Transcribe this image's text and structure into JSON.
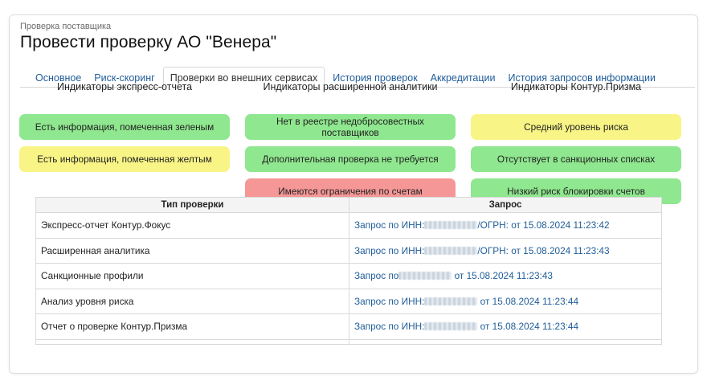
{
  "breadcrumb": "Проверка поставщика",
  "title": "Провести проверку АО \"Венера\"",
  "tabs": [
    {
      "label": "Основное"
    },
    {
      "label": "Риск-скоринг"
    },
    {
      "label": "Проверки во внешних сервисах"
    },
    {
      "label": "История проверок"
    },
    {
      "label": "Аккредитации"
    },
    {
      "label": "История запросов информации"
    }
  ],
  "columns": [
    {
      "title": "Индикаторы экспресс-отчета",
      "items": [
        {
          "text": "Есть информация, помеченная зеленым",
          "status": "green"
        },
        {
          "text": "Есть информация, помеченная желтым",
          "status": "yellow"
        }
      ]
    },
    {
      "title": "Индикаторы расширенной аналитики",
      "items": [
        {
          "text": "Нет в реестре недобросовестных поставщиков",
          "status": "green"
        },
        {
          "text": "Дополнительная проверка не требуется",
          "status": "green"
        },
        {
          "text": "Имеются ограничения по счетам",
          "status": "red"
        }
      ]
    },
    {
      "title": "Индикаторы Контур.Призма",
      "items": [
        {
          "text": "Средний уровень риска",
          "status": "yellow"
        },
        {
          "text": "Отсутствует в санкционных списках",
          "status": "green"
        },
        {
          "text": "Низкий риск блокировки счетов",
          "status": "green"
        }
      ]
    }
  ],
  "colors": {
    "green": "#8fe78f",
    "yellow": "#f8f586",
    "red": "#f59797",
    "link": "#1f5c99"
  },
  "table": {
    "headers": [
      "Тип проверки",
      "Запрос"
    ],
    "rows": [
      {
        "type": "Экспресс-отчет Контур.Фокус",
        "req_prefix": "Запрос по ИНН:",
        "req_suffix": "/ОГРН: от 15.08.2024 11:23:42"
      },
      {
        "type": "Расширенная аналитика",
        "req_prefix": "Запрос по ИНН:",
        "req_suffix": "/ОГРН: от 15.08.2024 11:23:43"
      },
      {
        "type": "Санкционные профили",
        "req_prefix": "Запрос по",
        "req_suffix": " от 15.08.2024 11:23:43"
      },
      {
        "type": "Анализ уровня риска",
        "req_prefix": "Запрос по ИНН:",
        "req_suffix": " от 15.08.2024 11:23:44"
      },
      {
        "type": "Отчет о проверке Контур.Призма",
        "req_prefix": "Запрос по ИНН:",
        "req_suffix": " от 15.08.2024 11:23:44"
      }
    ]
  }
}
